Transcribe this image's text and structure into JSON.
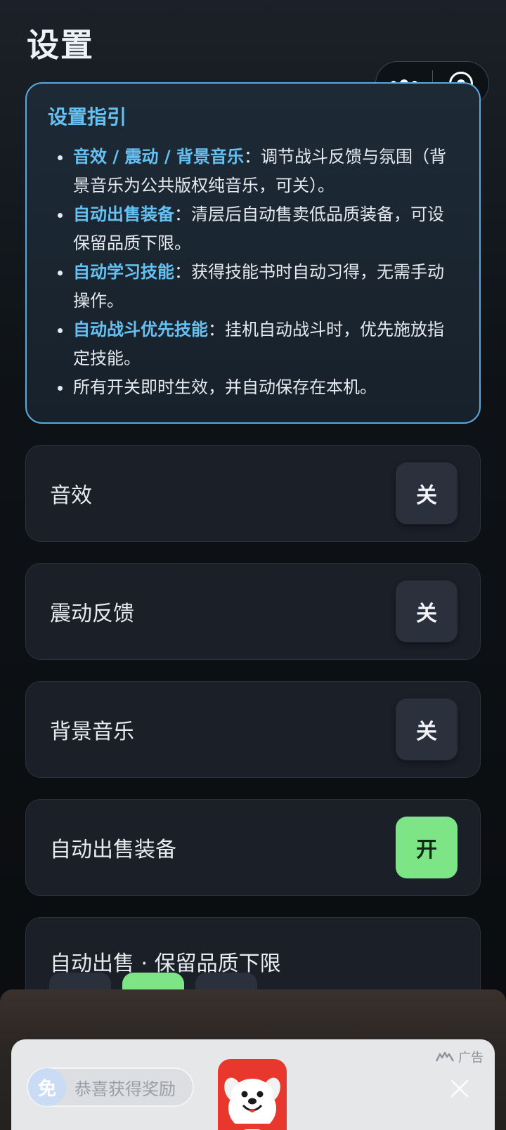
{
  "header": {
    "title": "设置"
  },
  "capsule": {
    "menu_icon": "more-dots-icon",
    "close_icon": "target-circle-icon"
  },
  "guide": {
    "title": "设置指引",
    "items": [
      {
        "highlight": "音效 / 震动 / 背景音乐",
        "text": "：调节战斗反馈与氛围（背景音乐为公共版权纯音乐，可关）。"
      },
      {
        "highlight": "自动出售装备",
        "text": "：清层后自动售卖低品质装备，可设保留品质下限。"
      },
      {
        "highlight": "自动学习技能",
        "text": "：获得技能书时自动习得，无需手动操作。"
      },
      {
        "highlight": "自动战斗优先技能",
        "text": "：挂机自动战斗时，优先施放指定技能。"
      },
      {
        "highlight": "",
        "text": "所有开关即时生效，并自动保存在本机。"
      }
    ]
  },
  "settings": [
    {
      "label": "音效",
      "state": "关",
      "on": false
    },
    {
      "label": "震动反馈",
      "state": "关",
      "on": false
    },
    {
      "label": "背景音乐",
      "state": "关",
      "on": false
    },
    {
      "label": "自动出售装备",
      "state": "开",
      "on": true
    }
  ],
  "quality_floor": {
    "label": "自动出售 · 保留品质下限",
    "selected_index": 1
  },
  "ad": {
    "tag": "广告",
    "reward_badge": "免",
    "reward_text": "恭喜获得奖励",
    "close_icon": "close-icon"
  },
  "colors": {
    "accent": "#66c1f2",
    "toggle_on": "#7ee587",
    "toggle_off": "#2a303c"
  }
}
